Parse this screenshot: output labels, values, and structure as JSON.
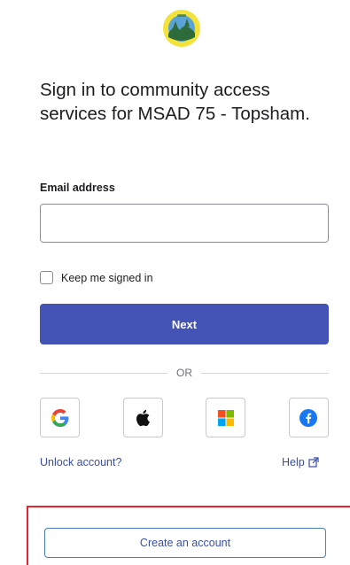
{
  "logo": {
    "icon": "msad75-seal-logo",
    "colors": {
      "ring": "#f2e23a",
      "inner": "#2d6b3a",
      "sky": "#5aa3d6"
    }
  },
  "heading": "Sign in to community access services for MSAD 75 - Topsham.",
  "email": {
    "label": "Email address",
    "value": "",
    "placeholder": ""
  },
  "keep_signed_in": {
    "label": "Keep me signed in",
    "checked": false
  },
  "next_button": {
    "label": "Next",
    "color": "#4453b6"
  },
  "divider": {
    "text": "OR"
  },
  "identity_providers": [
    {
      "name": "Google",
      "icon": "google-icon"
    },
    {
      "name": "Apple",
      "icon": "apple-icon"
    },
    {
      "name": "Microsoft",
      "icon": "microsoft-icon"
    },
    {
      "name": "Facebook",
      "icon": "facebook-icon"
    }
  ],
  "links": {
    "unlock": "Unlock account?",
    "help": "Help"
  },
  "create_account": {
    "label": "Create an account",
    "highlight_color": "#e8232f"
  }
}
